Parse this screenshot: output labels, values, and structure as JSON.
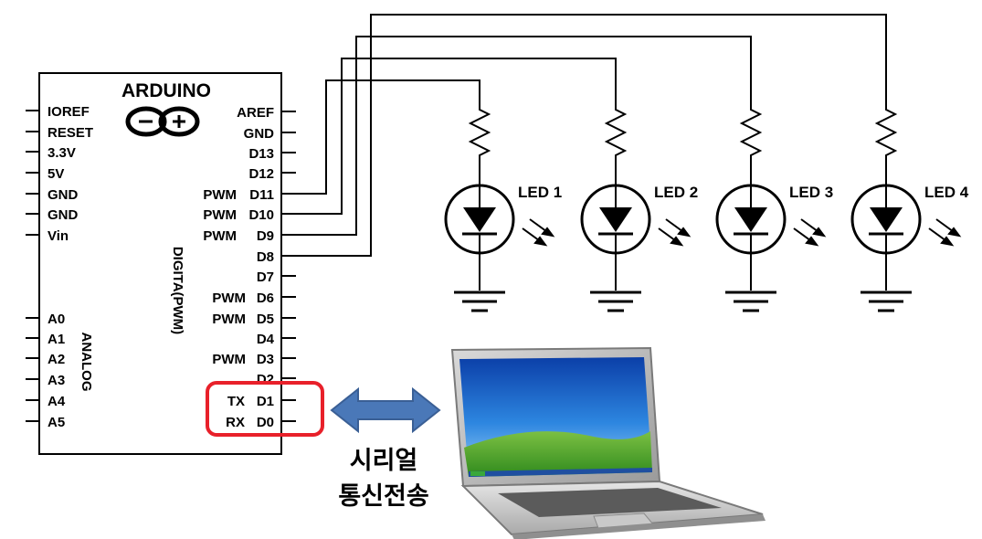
{
  "board": {
    "title": "ARDUINO",
    "left_pins": [
      "IOREF",
      "RESET",
      "3.3V",
      "5V",
      "GND",
      "GND",
      "Vin"
    ],
    "analog_pins": [
      "A0",
      "A1",
      "A2",
      "A3",
      "A4",
      "A5"
    ],
    "analog_label": "ANALOG",
    "digital_label": "DIGITA(PWM)",
    "right_pins": [
      "AREF",
      "GND",
      "D13",
      "D12",
      "D11",
      "D10",
      "D9",
      "D8",
      "D7",
      "D6",
      "D5",
      "D4",
      "D3",
      "D2",
      "D1",
      "D0"
    ],
    "pwm_label": "PWM",
    "tx_label": "TX",
    "rx_label": "RX"
  },
  "leds": [
    {
      "label": "LED 1"
    },
    {
      "label": "LED 2"
    },
    {
      "label": "LED 3"
    },
    {
      "label": "LED 4"
    }
  ],
  "serial_label": [
    "시리얼",
    "통신전송"
  ],
  "colors": {
    "highlight": "#e8202a",
    "arrow_fill": "#4a78b8",
    "arrow_stroke": "#3a5f95",
    "wire": "#000000"
  }
}
